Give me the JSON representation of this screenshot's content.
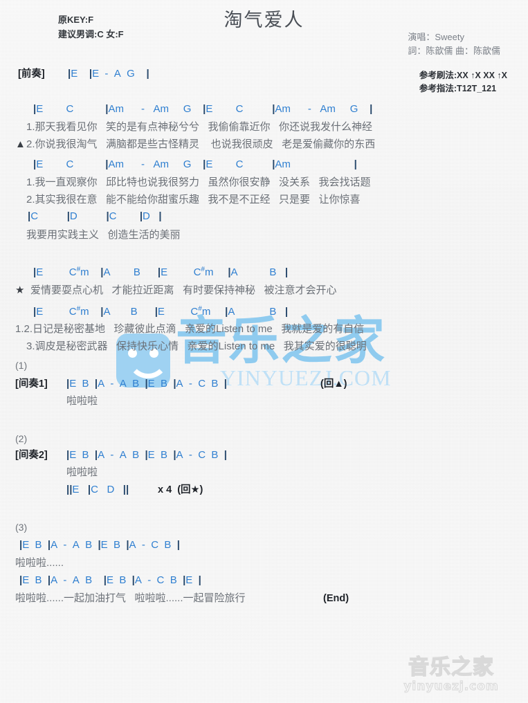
{
  "header": {
    "title": "淘气爱人",
    "original_key": "原KEY:F",
    "suggested_key": "建议男调:C 女:F",
    "singer": "演唱：Sweety",
    "writer_composer": "詞：陈歆儒  曲：陈歆儒",
    "strum_pattern": "参考刷法:XX ↑X XX ↑X",
    "fingering": "参考指法:T12T_121"
  },
  "watermarks": {
    "center_cn": "音乐之家",
    "center_en": "YINYUEZJ.COM",
    "corner_cn": "音乐之家",
    "corner_en": "yinyuezj.com"
  },
  "prelude": {
    "tag": "[前奏]",
    "chords": "|E    |E  -  A  G    |"
  },
  "verse1": {
    "chord_line_1": "|E        C           |Am      -   Am     G    |E        C          |Am      -   Am     G    |",
    "lyric_1a": "1.那天我看见你   笑的是有点神秘兮兮   我偷偷靠近你   你还说我发什么神经",
    "lyric_1b_marker": "▲",
    "lyric_1b": "2.你说我很淘气   满脑都是些古怪精灵    也说我很顽皮   老是爱偷藏你的东西",
    "chord_line_2": "|E        C           |Am      -   Am     G    |E        C          |Am                      |",
    "lyric_2a": "1.我一直观察你   邱比特也说我很努力   虽然你很安静   没关系   我会找话题",
    "lyric_2b": "2.其实我很在意   能不能给你甜蜜乐趣   我不是不正经   只是要   让你惊喜",
    "chord_line_3": "|C          |D          |C        |D   |",
    "lyric_3": "我要用实践主义   创造生活的美丽"
  },
  "chorus": {
    "chord_line_1": "|E         C#m    |A        B      |E         C#m     |A           B   |",
    "marker": "★",
    "lyric_1": "爱情要耍点心机   才能拉近距离   有时要保持神秘   被注意才会开心",
    "chord_line_2": "|E         C#m    |A       B      |E         C#m     |A            B   |",
    "lyric_2a": "1.2.日记是秘密基地   珍藏彼此点滴   亲爱的Listen to me   我就是爱的有自信",
    "lyric_2b": "3.调皮是秘密武器   保持快乐心情   亲爱的Listen to me   我其实爱的很聪明"
  },
  "interlude1": {
    "number": "(1)",
    "tag": "[间奏1]",
    "chords": "|E  B  |A  -  A  B  |E  B  |A  -  C  B  |",
    "repeat": "(回▲)",
    "lyric": "啦啦啦"
  },
  "interlude2": {
    "number": "(2)",
    "tag": "[间奏2]",
    "chords": "|E  B  |A  -  A  B  |E  B  |A  -  C  B  |",
    "lyric": "啦啦啦",
    "extra_chords": "||E   |C   D   ||",
    "extra_repeat": "x 4  (回★)"
  },
  "ending": {
    "number": "(3)",
    "chord_line_1": "|E  B  |A  -  A  B  |E  B  |A  -  C  B  |",
    "lyric_1": "啦啦啦......",
    "chord_line_2": "|E  B  |A  -  A  B    |E  B  |A  -  C  B  |E  |",
    "lyric_2": "啦啦啦......一起加油打气   啦啦啦......一起冒险旅行",
    "end_label": "(End)"
  }
}
